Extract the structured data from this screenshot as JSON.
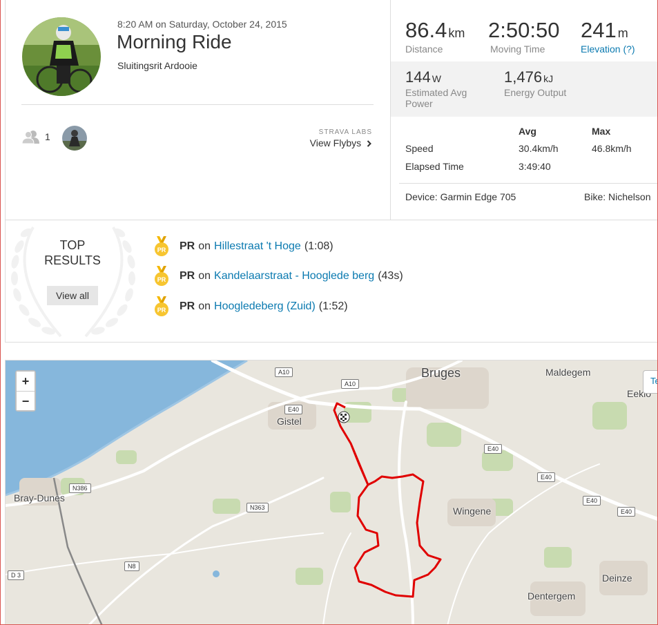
{
  "activity": {
    "datetime": "8:20 AM on Saturday, October 24, 2015",
    "title": "Morning Ride",
    "description": "Sluitingsrit Ardooie",
    "athlete_count": "1",
    "labs_tag": "STRAVA LABS",
    "flybys_link": "View Flybys"
  },
  "stats": {
    "distance": {
      "value": "86.4",
      "unit": "km",
      "label": "Distance"
    },
    "moving_time": {
      "value": "2:50:50",
      "label": "Moving Time"
    },
    "elevation": {
      "value": "241",
      "unit": "m",
      "label": "Elevation (?)"
    },
    "power": {
      "value": "144",
      "unit": "W",
      "label_line1": "Estimated Avg",
      "label_line2": "Power"
    },
    "energy": {
      "value": "1,476",
      "unit": "kJ",
      "label": "Energy Output"
    },
    "table": {
      "headers": [
        "",
        "Avg",
        "Max"
      ],
      "rows": [
        [
          "Speed",
          "30.4km/h",
          "46.8km/h"
        ],
        [
          "Elapsed Time",
          "3:49:40",
          ""
        ]
      ]
    },
    "device": "Device: Garmin Edge 705",
    "bike": "Bike: Nichelson"
  },
  "results": {
    "heading_line1": "TOP",
    "heading_line2": "RESULTS",
    "view_all": "View all",
    "items": [
      {
        "tag": "PR",
        "on": "on",
        "segment": "Hillestraat 't Hoge",
        "time": "(1:08)"
      },
      {
        "tag": "PR",
        "on": "on",
        "segment": "Kandelaarstraat - Hooglede berg",
        "time": "(43s)"
      },
      {
        "tag": "PR",
        "on": "on",
        "segment": "Hoogledeberg (Zuid)",
        "time": "(1:52)"
      }
    ]
  },
  "map": {
    "zoom_in": "+",
    "zoom_out": "−",
    "edge_button": "Te",
    "route_color": "#e00000",
    "places": {
      "bruges": "Bruges",
      "maldegem": "Maldegem",
      "eeklo": "Eeklo",
      "gistel": "Gistel",
      "bray_dunes": "Bray-Dunes",
      "wingene": "Wingene",
      "deinze": "Deinze",
      "dentergem": "Dentergem"
    },
    "roads": {
      "a10a": "A10",
      "a10b": "A10",
      "e40a": "E40",
      "e40b": "E40",
      "e40c": "E40",
      "e40d": "E40",
      "e40e": "E40",
      "n386": "N386",
      "n363": "N363",
      "n8": "N8",
      "d3": "D 3"
    }
  }
}
